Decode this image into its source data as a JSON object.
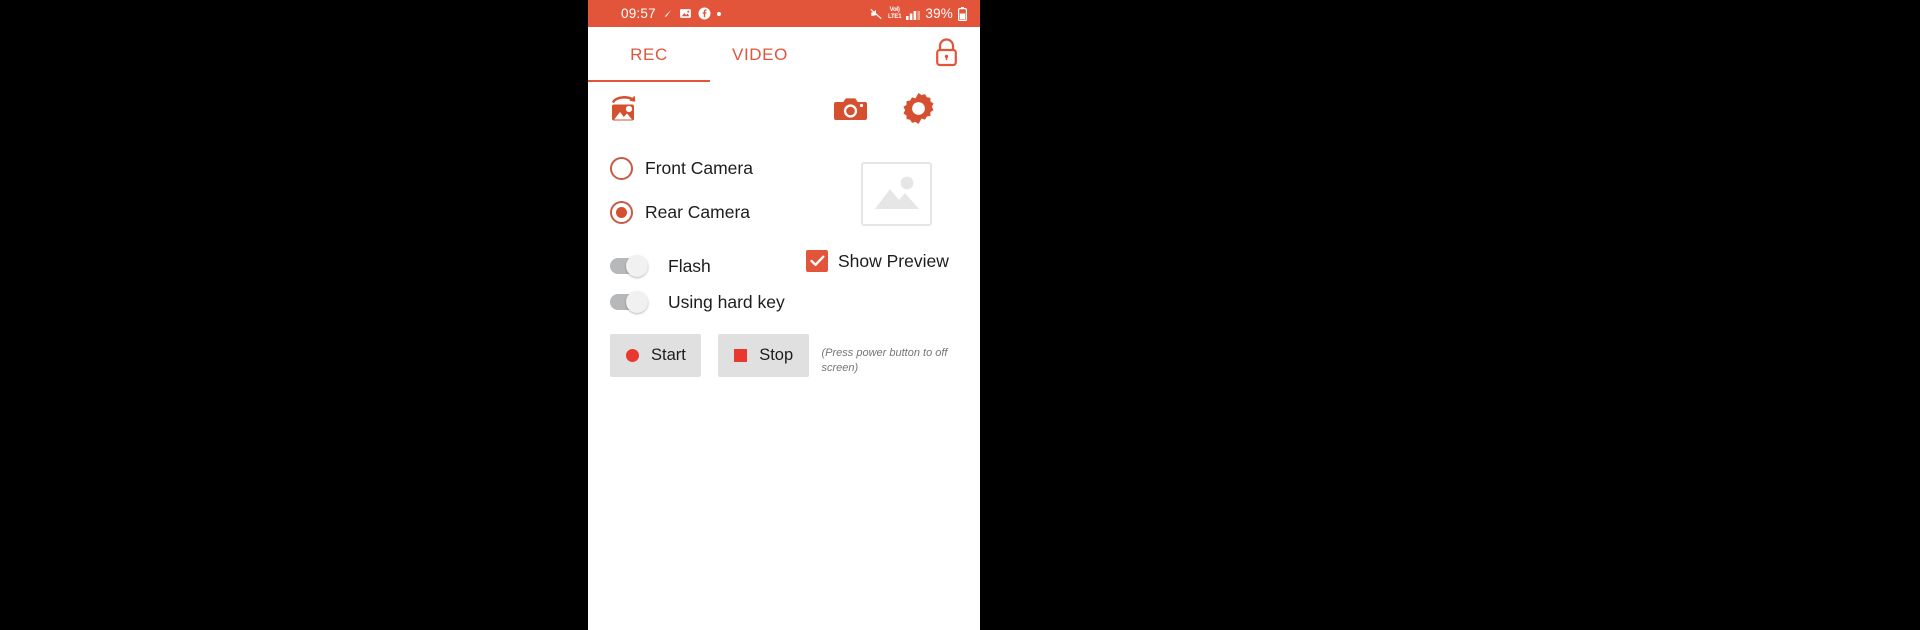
{
  "statusbar": {
    "time": "09:57",
    "battery_percent": "39%",
    "icons_left": [
      "pen-icon",
      "image-icon",
      "facebook-icon",
      "dot-icon"
    ],
    "icons_right": [
      "mute-icon",
      "volte-icon",
      "signal-icon",
      "battery-icon"
    ],
    "volte_line1": "VoI)",
    "volte_line2": "LTE1",
    "accent": "#E2553A"
  },
  "tabs": [
    {
      "label": "REC",
      "active": true,
      "name": "tab-rec"
    },
    {
      "label": "VIDEO",
      "active": false,
      "name": "tab-video"
    }
  ],
  "header": {
    "lock_icon": "lock-icon"
  },
  "iconrow": {
    "swap_camera": "swap-camera-icon",
    "camera": "camera-icon",
    "settings": "gear-icon"
  },
  "camera_options": {
    "front": {
      "label": "Front Camera",
      "selected": false
    },
    "rear": {
      "label": "Rear Camera",
      "selected": true
    }
  },
  "preview": {
    "thumbnail_icon": "image-placeholder-icon"
  },
  "toggles": {
    "flash": {
      "label": "Flash",
      "on": false
    },
    "hard_key": {
      "label": "Using hard key",
      "on": false
    }
  },
  "checkbox": {
    "show_preview": {
      "label": "Show Preview",
      "checked": true
    }
  },
  "buttons": {
    "start": "Start",
    "stop": "Stop"
  },
  "hint": "(Press power button to off screen)",
  "colors": {
    "accent": "#E2553A",
    "record_red": "#E8382F",
    "button_grey": "#E0E0E0",
    "toggle_grey": "#B6B8BA"
  }
}
